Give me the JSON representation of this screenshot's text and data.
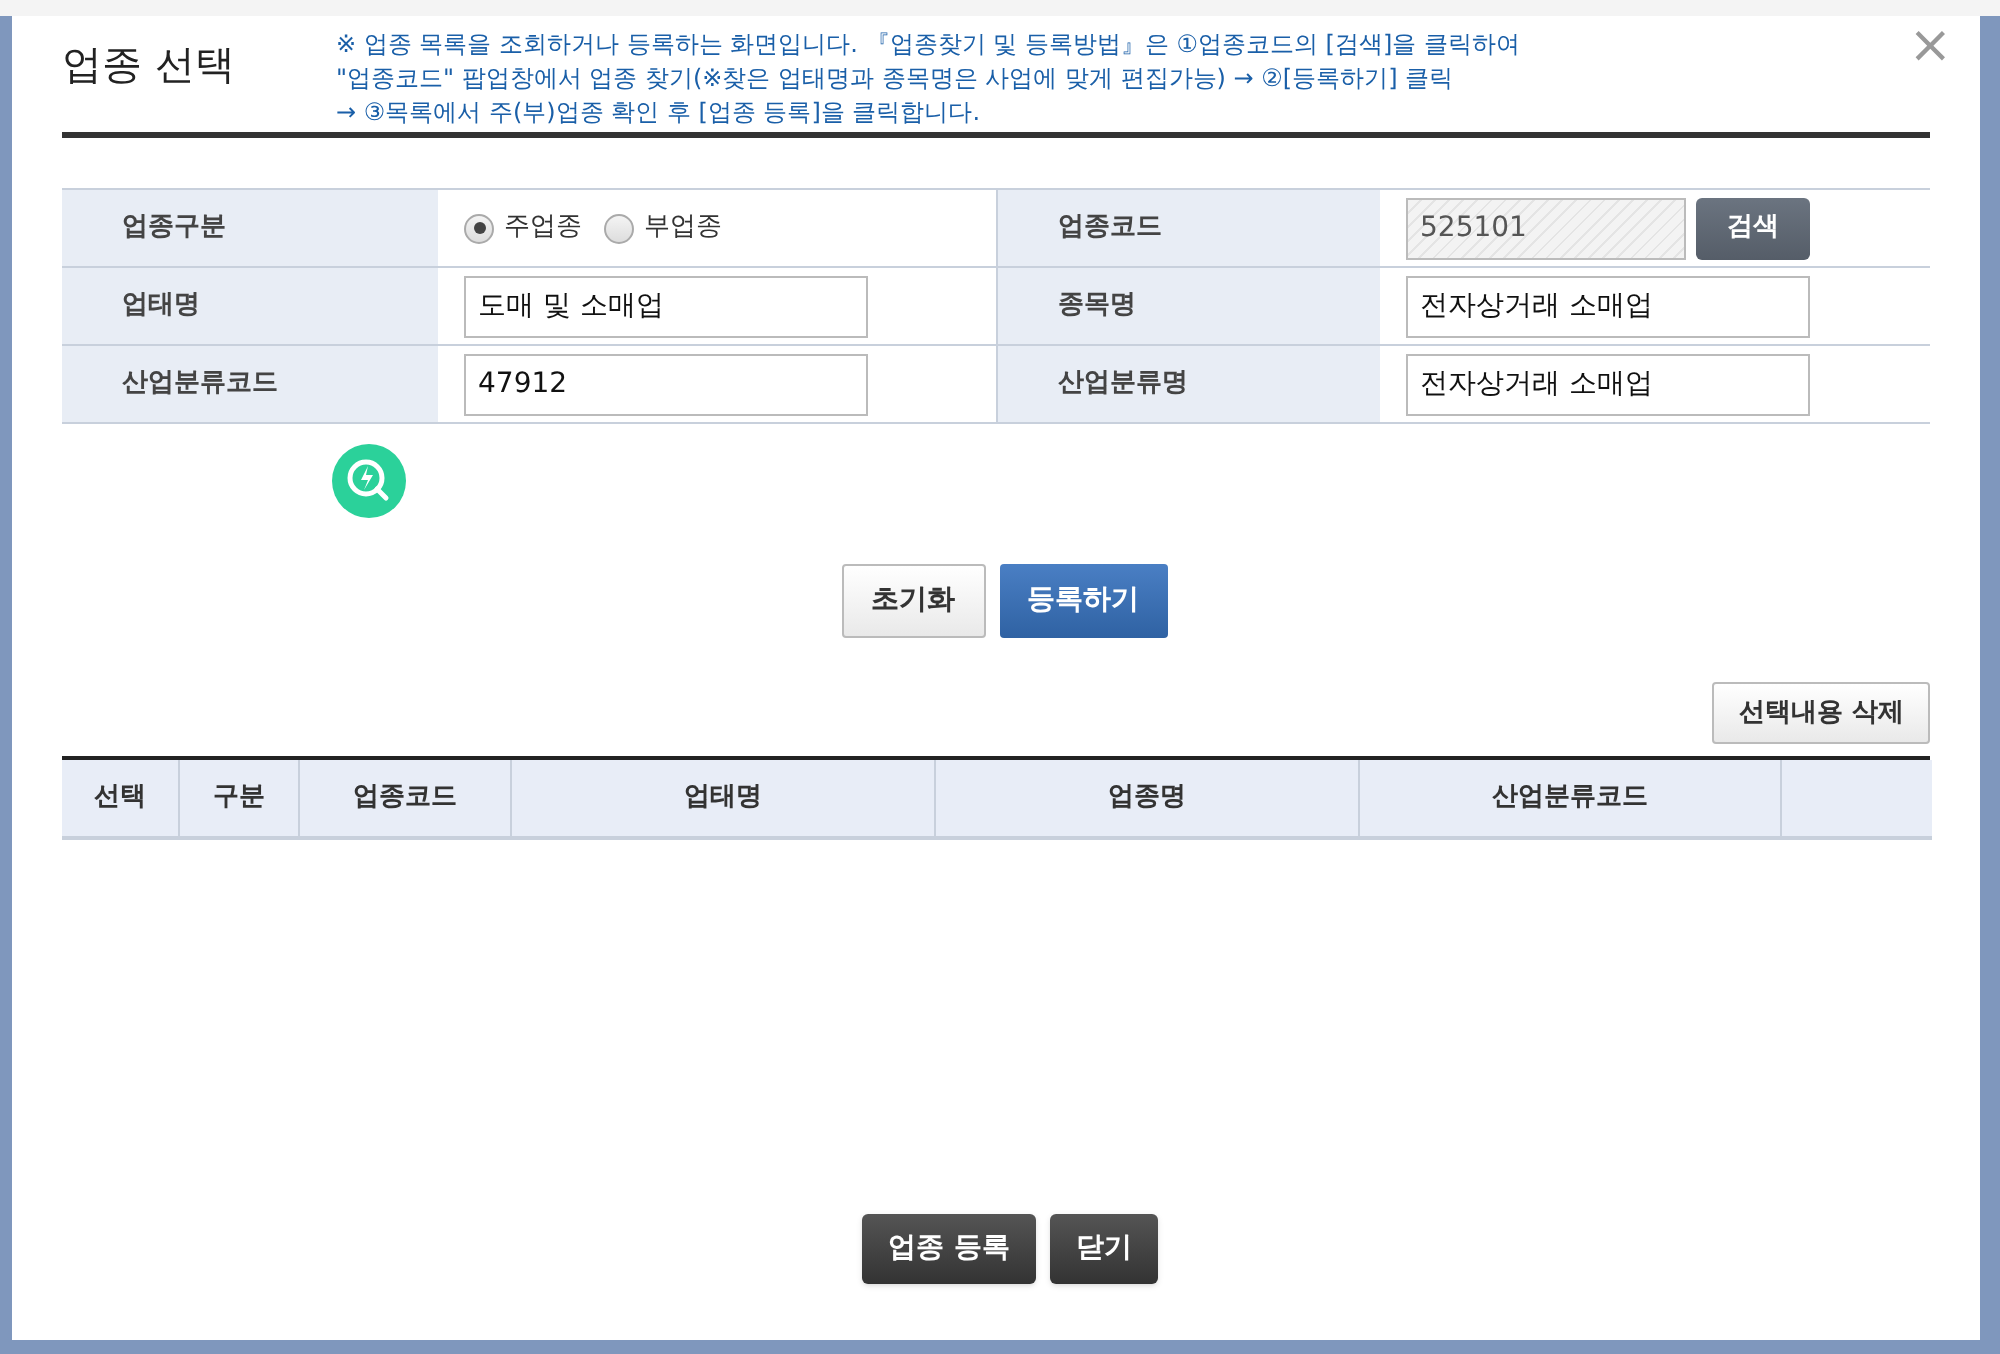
{
  "dialog": {
    "title": "업종 선택",
    "notice_lines": [
      "※ 업종 목록을 조회하거나 등록하는 화면입니다. 『업종찾기 및 등록방법』은 ①업종코드의 [검색]을 클릭하여",
      "\"업종코드\" 팝업창에서 업종 찾기(※찾은 업태명과 종목명은 사업에 맞게 편집가능) → ②[등록하기] 클릭",
      "→ ③목록에서 주(부)업종 확인 후 [업종 등록]을 클릭합니다."
    ],
    "close": "×"
  },
  "form": {
    "rows": [
      {
        "left": {
          "label": "업종구분",
          "kind": "radio",
          "options": [
            {
              "label": "주업종",
              "selected": true
            },
            {
              "label": "부업종",
              "selected": false
            }
          ]
        },
        "right": {
          "label": "업종코드",
          "kind": "search",
          "value": "525101",
          "button": "검색"
        }
      },
      {
        "left": {
          "label": "업태명",
          "kind": "input",
          "value": "도매 및 소매업"
        },
        "right": {
          "label": "종목명",
          "kind": "input",
          "value": "전자상거래 소매업"
        }
      },
      {
        "left": {
          "label": "산업분류코드",
          "kind": "input",
          "value": "47912"
        },
        "right": {
          "label": "산업분류명",
          "kind": "input",
          "value": "전자상거래 소매업"
        }
      }
    ]
  },
  "form_buttons": [
    {
      "label": "초기화",
      "kind": "light"
    },
    {
      "label": "등록하기",
      "kind": "primary"
    }
  ],
  "delete_button": "선택내용 삭제",
  "table": {
    "columns": [
      "선택",
      "구분",
      "업종코드",
      "업태명",
      "업종명",
      "산업분류코드"
    ]
  },
  "footer_buttons": [
    "업종 등록",
    "닫기"
  ]
}
